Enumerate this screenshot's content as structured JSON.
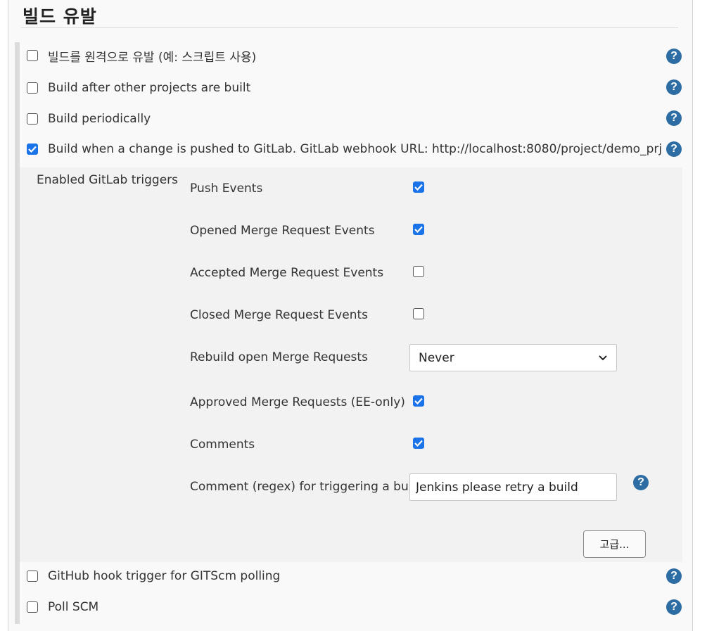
{
  "section": {
    "title": "빌드 유발"
  },
  "triggers": [
    {
      "label": "빌드를 원격으로 유발 (예: 스크립트 사용)",
      "checked": false
    },
    {
      "label": "Build after other projects are built",
      "checked": false
    },
    {
      "label": "Build periodically",
      "checked": false
    },
    {
      "label": "Build when a change is pushed to GitLab. GitLab webhook URL: http://localhost:8080/project/demo_prj",
      "checked": true
    },
    {
      "label": "GitHub hook trigger for GITScm polling",
      "checked": false
    },
    {
      "label": "Poll SCM",
      "checked": false
    }
  ],
  "help_icon": {
    "glyph": "?"
  },
  "gitlab": {
    "title": "Enabled GitLab triggers",
    "events": [
      {
        "label": "Push Events",
        "checked": true
      },
      {
        "label": "Opened Merge Request Events",
        "checked": true
      },
      {
        "label": "Accepted Merge Request Events",
        "checked": false
      },
      {
        "label": "Closed Merge Request Events",
        "checked": false
      },
      {
        "label": "Approved Merge Requests (EE-only)",
        "checked": true
      },
      {
        "label": "Comments",
        "checked": true
      }
    ],
    "rebuild": {
      "label": "Rebuild open Merge Requests",
      "value": "Never"
    },
    "comment_regex": {
      "label": "Comment (regex) for triggering a build",
      "value": "Jenkins please retry a build"
    },
    "advanced_button": "고급..."
  },
  "colors": {
    "checkbox_on": "#1a73e8",
    "help": "#2e6da4",
    "panel": "#f2f2f2"
  }
}
